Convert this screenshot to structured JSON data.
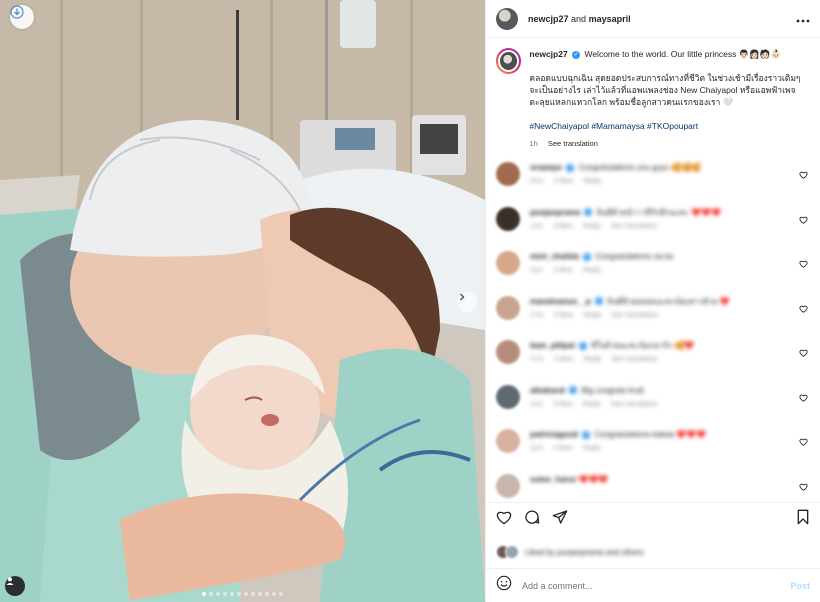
{
  "header": {
    "user1": "newcjp27",
    "and": "and",
    "user2": "maysapril",
    "more_icon": "more-horizontal-icon"
  },
  "caption": {
    "username": "newcjp27",
    "text": "Welcome to the world. Our little princess 👨🏻👩🏻🧑🏻👶🏻",
    "thai": "คลอดแบบฉุกเฉิน สุดยอดประสบการณ์ทางที่ชีวิต ในช่วงเช้ามีเรื่องราวเติมๆ จะเป็นอย่างไร เล่าไว้แล้วที่แอพแพลงช่อง New Chaiyapol หรือแอพฟ้าเพจ ตะลุยแหลกแหวกโลก พร้อมชื่อลูกสาวคนแรกของเรา 🤍",
    "hashtags": "#NewChaiyapol #Mamamaysa #TKOpoupart",
    "time": "1h",
    "see_translation": "See translation"
  },
  "comments": [
    {
      "user": "orawaye",
      "verified": true,
      "text": "Congratulations you guys 🥰🥰🥰",
      "time": "41m",
      "likes": "3 likes",
      "reply": "Reply",
      "translate": "",
      "avatar_color": "#a36b4d"
    },
    {
      "user": "punjanprama",
      "verified": true,
      "text": "ยินดีด้วยน้าาาที่รักอีกนะคะ ❤️❤️❤️",
      "time": "11m",
      "likes": "3 likes",
      "reply": "Reply",
      "translate": "See translation",
      "avatar_color": "#3a2f2a"
    },
    {
      "user": "mint_chalida",
      "verified": true,
      "text": "Congratulations na ka",
      "time": "11m",
      "likes": "3 likes",
      "reply": "Reply",
      "translate": "",
      "avatar_color": "#d6a789"
    },
    {
      "user": "manatsanun__p",
      "verified": true,
      "text": "ยินดีด้วยยยยยนะคะน้องสาวด้วย ❤️",
      "time": "17m",
      "likes": "5 likes",
      "reply": "Reply",
      "translate": "See translation",
      "avatar_color": "#c9a38e"
    },
    {
      "user": "bam_pitipat",
      "verified": true,
      "text": "ดีใจด้วยนะคะน้องน่ารัก 🥰❤️",
      "time": "17m",
      "likes": "3 likes",
      "reply": "Reply",
      "translate": "See translation",
      "avatar_color": "#b88c7a"
    },
    {
      "user": "aktakarat",
      "verified": true,
      "text": "Big congrats krub",
      "time": "11m",
      "likes": "3 likes",
      "reply": "Reply",
      "translate": "See translation",
      "avatar_color": "#5d6a72"
    },
    {
      "user": "patriciagood",
      "verified": true,
      "text": "Congratulations kakaa ❤️❤️❤️",
      "time": "11m",
      "likes": "2 likes",
      "reply": "Reply",
      "translate": "",
      "avatar_color": "#d9b1a0"
    },
    {
      "user": "sotee_hansi",
      "verified": false,
      "text": "❤️❤️❤️",
      "time": "",
      "likes": "",
      "reply": "",
      "translate": "",
      "avatar_color": "#c8b6aa"
    }
  ],
  "likes": {
    "text": "Liked by punjanprama and others"
  },
  "add_comment": {
    "placeholder": "Add a comment...",
    "post": "Post"
  },
  "media": {
    "active_slide": 1,
    "slide_count": 12
  },
  "colors": {
    "link": "#00376b",
    "post_disabled": "#b3dbff",
    "verified": "#3897f0"
  }
}
